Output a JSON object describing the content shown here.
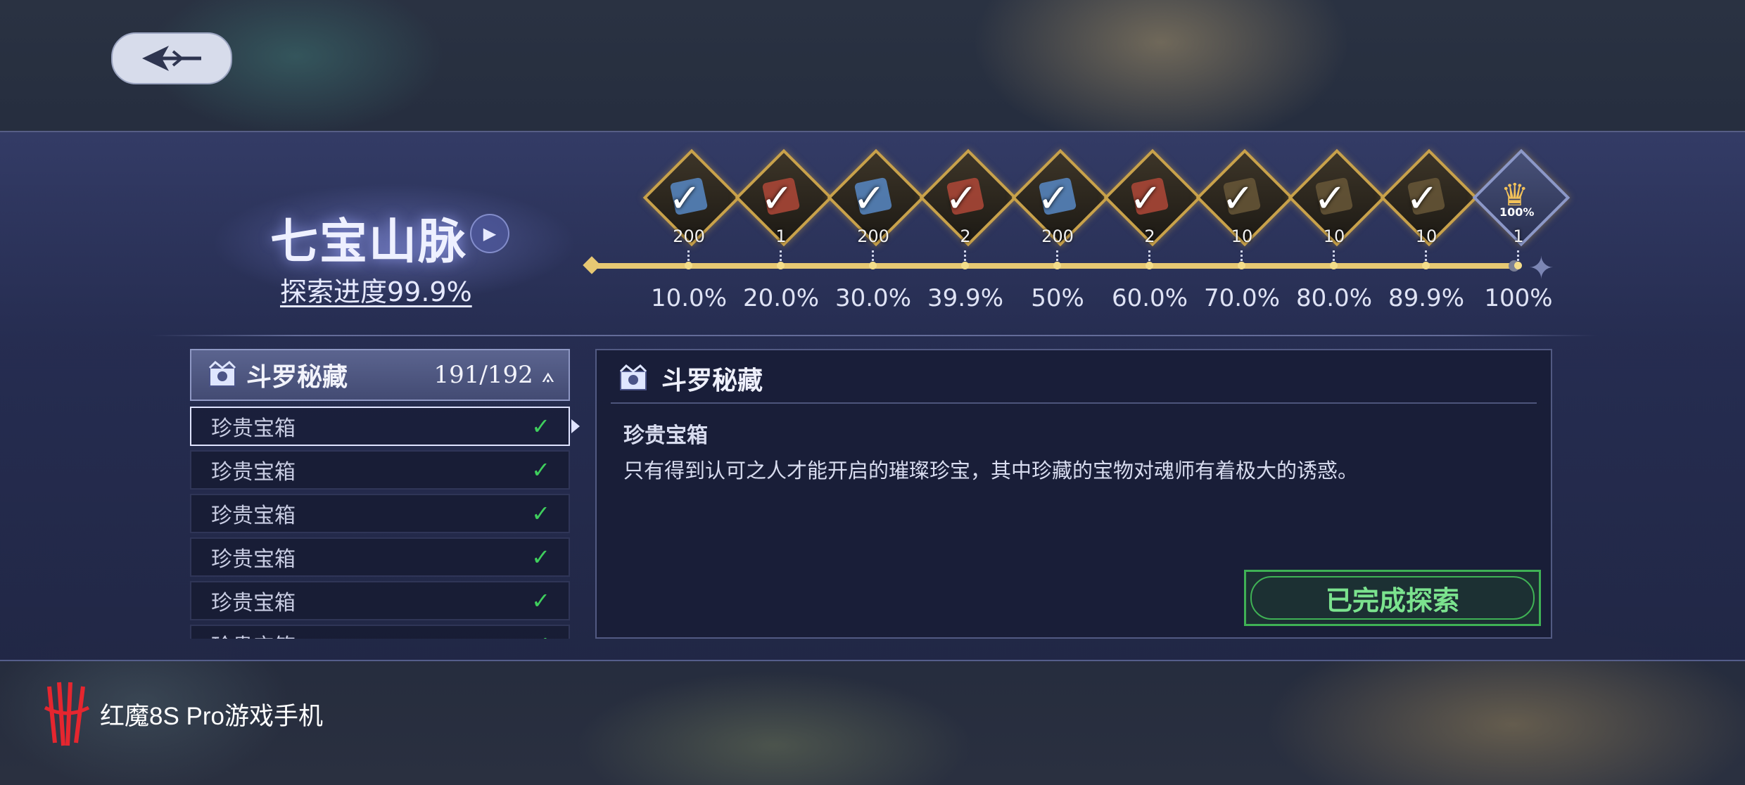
{
  "region": {
    "title": "七宝山脉",
    "progress_text": "探索进度99.9%"
  },
  "milestones": [
    {
      "reward": "200",
      "percent": "10.0%",
      "icon": "gem-icon"
    },
    {
      "reward": "1",
      "percent": "20.0%",
      "icon": "scroll-icon"
    },
    {
      "reward": "200",
      "percent": "30.0%",
      "icon": "gem-icon"
    },
    {
      "reward": "2",
      "percent": "39.9%",
      "icon": "scroll-icon"
    },
    {
      "reward": "200",
      "percent": "50%",
      "icon": "gem-icon"
    },
    {
      "reward": "2",
      "percent": "60.0%",
      "icon": "scroll-icon"
    },
    {
      "reward": "10",
      "percent": "70.0%",
      "icon": "item-icon"
    },
    {
      "reward": "10",
      "percent": "80.0%",
      "icon": "item-icon"
    },
    {
      "reward": "10",
      "percent": "89.9%",
      "icon": "item-icon"
    },
    {
      "reward": "1",
      "percent": "100%",
      "icon": "trophy-icon",
      "badge": "100%"
    }
  ],
  "list": {
    "title": "斗罗秘藏",
    "count": "191/192",
    "items": [
      {
        "label": "珍贵宝箱",
        "done": true
      },
      {
        "label": "珍贵宝箱",
        "done": true
      },
      {
        "label": "珍贵宝箱",
        "done": true
      },
      {
        "label": "珍贵宝箱",
        "done": true
      },
      {
        "label": "珍贵宝箱",
        "done": true
      },
      {
        "label": "珍贵宝箱",
        "done": true
      }
    ]
  },
  "detail": {
    "title": "斗罗秘藏",
    "item_name": "珍贵宝箱",
    "description": "只有得到认可之人才能开启的璀璨珍宝，其中珍藏的宝物对魂师有着极大的诱惑。",
    "status_button": "已完成探索"
  },
  "watermark": {
    "text": "红魔8S Pro游戏手机"
  },
  "colors": {
    "gold": "#e7c873",
    "complete_green": "#3fb155",
    "check_green": "#3fcf5d"
  }
}
